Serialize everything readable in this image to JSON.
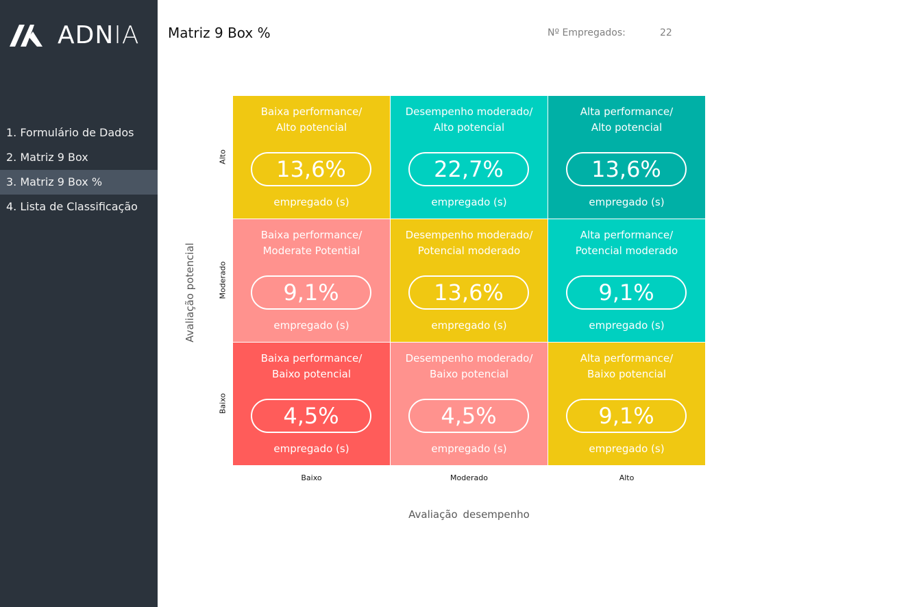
{
  "app": {
    "logo_text": "ADN",
    "logo_text_light": "IA"
  },
  "nav": [
    {
      "label": "1. Formulário de Dados",
      "active": false
    },
    {
      "label": "2. Matriz 9 Box",
      "active": false
    },
    {
      "label": "3. Matriz 9 Box %",
      "active": true
    },
    {
      "label": "4. Lista de Classificação",
      "active": false
    }
  ],
  "header": {
    "title": "Matriz 9 Box %",
    "employees_label": "Nº Empregados:",
    "employees_count": "22"
  },
  "matrix": {
    "y_axis_title": "Avaliação potencial",
    "x_axis_title": "Avaliação  desempenho",
    "y_ticks": [
      "Alto",
      "Moderado",
      "Baixo"
    ],
    "x_ticks": [
      "Baixo",
      "Moderado",
      "Alto"
    ],
    "colors": {
      "yellow": "#f0c812",
      "teal": "#00d0c0",
      "dark_teal": "#00b0a6",
      "salmon": "#ff928e",
      "red": "#ff5c5a"
    },
    "cells": [
      {
        "line1": "Baixa performance/",
        "line2": "Alto potencial",
        "value": "13,6%",
        "unit": "empregado (s)",
        "color": "#f0c812"
      },
      {
        "line1": "Desempenho moderado/",
        "line2": "Alto potencial",
        "value": "22,7%",
        "unit": "empregado (s)",
        "color": "#00d0c0"
      },
      {
        "line1": "Alta performance/",
        "line2": "Alto potencial",
        "value": "13,6%",
        "unit": "empregado (s)",
        "color": "#00b0a6"
      },
      {
        "line1": "Baixa performance/",
        "line2": "Moderate Potential",
        "value": "9,1%",
        "unit": "empregado (s)",
        "color": "#ff928e"
      },
      {
        "line1": "Desempenho moderado/",
        "line2": "Potencial moderado",
        "value": "13,6%",
        "unit": "empregado (s)",
        "color": "#f0c812"
      },
      {
        "line1": "Alta performance/",
        "line2": "Potencial moderado",
        "value": "9,1%",
        "unit": "empregado (s)",
        "color": "#00d0c0"
      },
      {
        "line1": "Baixa performance/",
        "line2": "Baixo potencial",
        "value": "4,5%",
        "unit": "empregado (s)",
        "color": "#ff5c5a"
      },
      {
        "line1": "Desempenho moderado/",
        "line2": "Baixo potencial",
        "value": "4,5%",
        "unit": "empregado (s)",
        "color": "#ff928e"
      },
      {
        "line1": "Alta performance/",
        "line2": "Baixo potencial",
        "value": "9,1%",
        "unit": "empregado (s)",
        "color": "#f0c812"
      }
    ]
  }
}
